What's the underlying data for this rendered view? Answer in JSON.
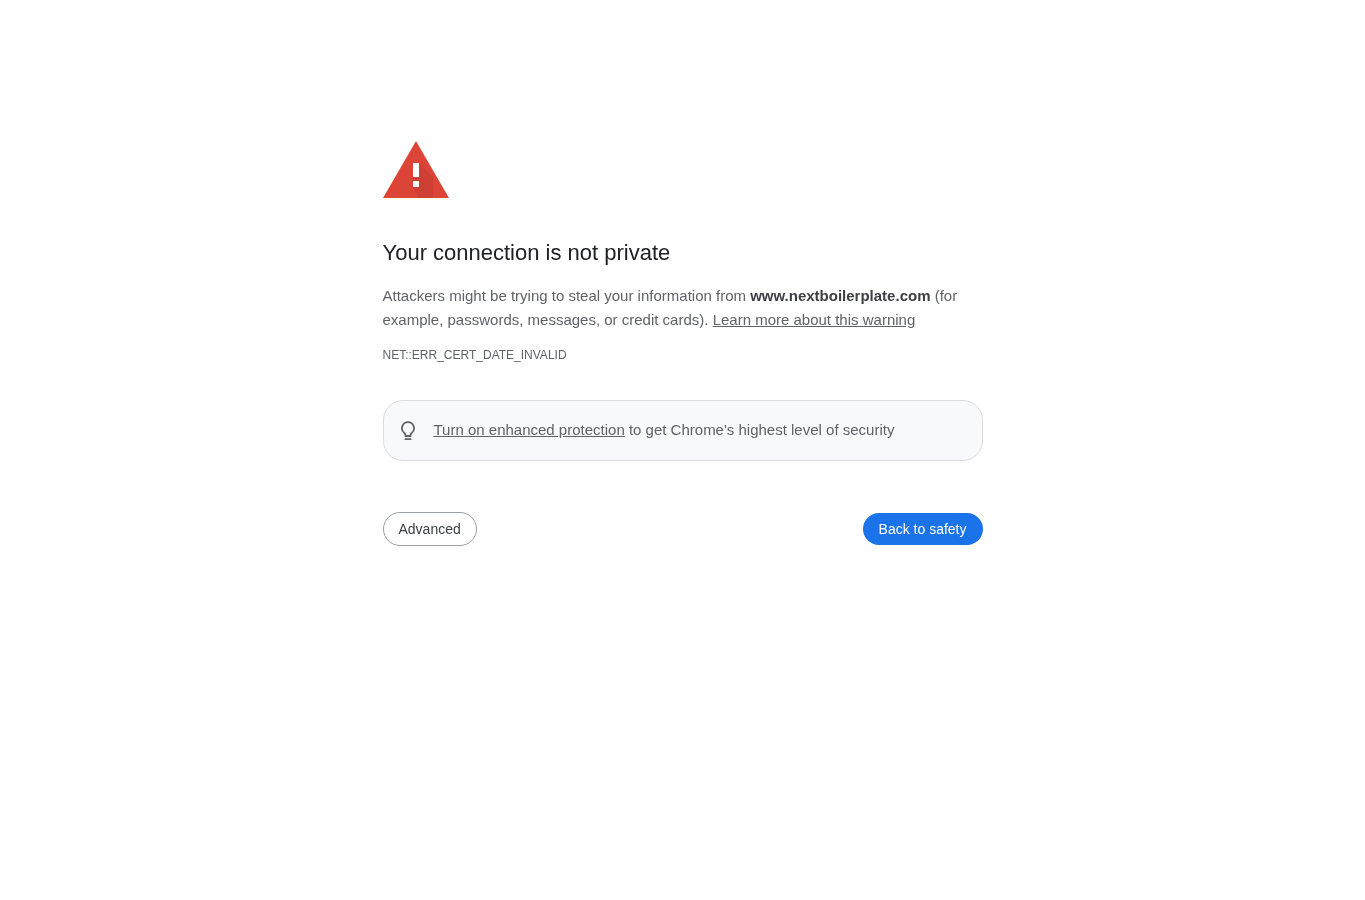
{
  "heading": "Your connection is not private",
  "message": {
    "text": "Attackers might be trying to steal your information from **www.nextboilerplate.com** (for example, passwords, messages, or credit cards).",
    "link": "Learn more about this warning"
  },
  "error_code": "NET::ERR_CERT_DATE_INVALID",
  "promo": {
    "link": "Turn on enhanced protection",
    "text": "to get Chrome's highest level of security"
  },
  "buttons": [
    {
      "label": "Advanced",
      "kind": "secondary"
    },
    {
      "label": "Back to safety",
      "kind": "primary"
    }
  ]
}
